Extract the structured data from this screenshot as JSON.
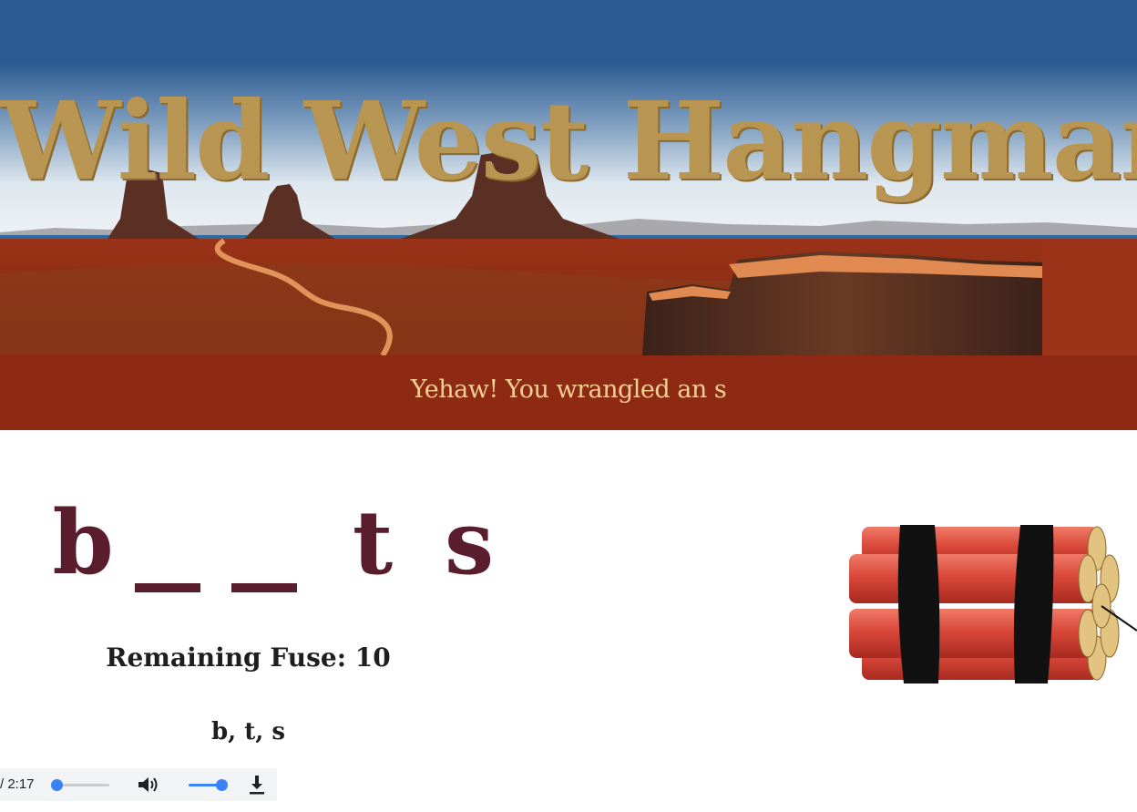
{
  "header": {
    "title": "Wild West Hangman"
  },
  "status": {
    "message": "Yehaw! You wrangled an s"
  },
  "puzzle": {
    "slots": [
      {
        "char": "b",
        "revealed": true
      },
      {
        "char": "",
        "revealed": false
      },
      {
        "char": "",
        "revealed": false
      },
      {
        "char": "t",
        "revealed": true
      },
      {
        "char": "s",
        "revealed": true
      }
    ]
  },
  "game": {
    "remaining_fuse_text": "Remaining Fuse: 10",
    "guessed_letters_text": "b, t, s"
  },
  "audio_player": {
    "time_text": "/ 2:17",
    "progress_fraction": 0.0,
    "volume_fraction": 1.0,
    "icons": [
      "volume-icon",
      "download-icon"
    ]
  },
  "colors": {
    "sky_top": "#2a5a91",
    "sky_bottom": "#c8d6e4",
    "desert_red": "#8e2a14",
    "title_gold": "#b99552",
    "message_text": "#f3cf93",
    "puzzle_letter": "#5a1d2e",
    "dynamite_red": "#d9483a",
    "progress_accent": "#3b82f6"
  }
}
